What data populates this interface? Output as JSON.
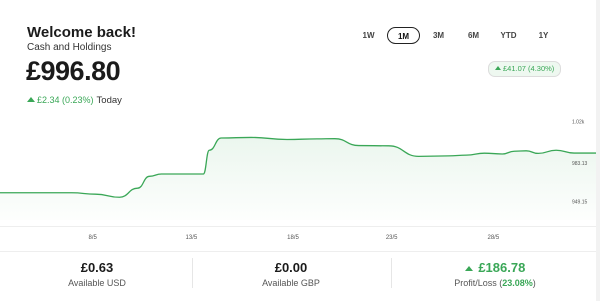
{
  "header": {
    "greeting": "Welcome back!",
    "subtitle": "Cash and Holdings",
    "balance": "£996.80",
    "day_change": "£2.34 (0.23%)",
    "today_label": "Today"
  },
  "range_tabs": [
    {
      "label": "1W",
      "active": false
    },
    {
      "label": "1M",
      "active": true
    },
    {
      "label": "3M",
      "active": false
    },
    {
      "label": "6M",
      "active": false
    },
    {
      "label": "YTD",
      "active": false
    },
    {
      "label": "1Y",
      "active": false
    }
  ],
  "period_change": "£41.07 (4.30%)",
  "chart_data": {
    "type": "area",
    "x_ticks": [
      "8/5",
      "13/5",
      "18/5",
      "23/5",
      "28/5"
    ],
    "y_ticks": [
      {
        "label": "1.02k",
        "value": 1020
      },
      {
        "label": "983.13",
        "value": 983.13
      },
      {
        "label": "949.15",
        "value": 949.15
      }
    ],
    "ylim": [
      940,
      1030
    ],
    "x": [
      0,
      0.06,
      0.12,
      0.16,
      0.2,
      0.23,
      0.25,
      0.27,
      0.3,
      0.34,
      0.35,
      0.37,
      0.42,
      0.48,
      0.53,
      0.56,
      0.6,
      0.65,
      0.7,
      0.75,
      0.78,
      0.81,
      0.84,
      0.86,
      0.88,
      0.9,
      0.93,
      0.96,
      1.0
    ],
    "values": [
      957,
      957,
      957,
      955.7,
      953,
      961,
      971.5,
      973.5,
      973.5,
      973.5,
      994.5,
      1005.3,
      1005.8,
      1004,
      1004.5,
      1004.7,
      998.6,
      998.4,
      989.1,
      989.5,
      990.2,
      991.9,
      991.2,
      993.6,
      994,
      991.7,
      994.5,
      992,
      992
    ],
    "color": "#3aa757"
  },
  "stats": [
    {
      "value": "£0.63",
      "label": "Available USD"
    },
    {
      "value": "£0.00",
      "label": "Available GBP"
    },
    {
      "value": "£186.78",
      "label_prefix": "Profit/Loss (",
      "label_pct": "23.08%",
      "label_suffix": ")"
    }
  ],
  "colors": {
    "accent": "#3aa757",
    "text": "#1b1b1b"
  },
  "icons": {
    "up_arrow": "up-triangle-icon"
  }
}
